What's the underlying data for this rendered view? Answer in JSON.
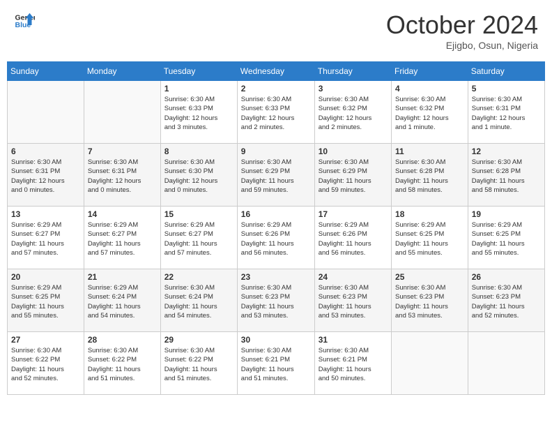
{
  "header": {
    "logo_line1": "General",
    "logo_line2": "Blue",
    "month": "October 2024",
    "location": "Ejigbo, Osun, Nigeria"
  },
  "days_of_week": [
    "Sunday",
    "Monday",
    "Tuesday",
    "Wednesday",
    "Thursday",
    "Friday",
    "Saturday"
  ],
  "weeks": [
    [
      {
        "num": "",
        "info": ""
      },
      {
        "num": "",
        "info": ""
      },
      {
        "num": "1",
        "info": "Sunrise: 6:30 AM\nSunset: 6:33 PM\nDaylight: 12 hours\nand 3 minutes."
      },
      {
        "num": "2",
        "info": "Sunrise: 6:30 AM\nSunset: 6:33 PM\nDaylight: 12 hours\nand 2 minutes."
      },
      {
        "num": "3",
        "info": "Sunrise: 6:30 AM\nSunset: 6:32 PM\nDaylight: 12 hours\nand 2 minutes."
      },
      {
        "num": "4",
        "info": "Sunrise: 6:30 AM\nSunset: 6:32 PM\nDaylight: 12 hours\nand 1 minute."
      },
      {
        "num": "5",
        "info": "Sunrise: 6:30 AM\nSunset: 6:31 PM\nDaylight: 12 hours\nand 1 minute."
      }
    ],
    [
      {
        "num": "6",
        "info": "Sunrise: 6:30 AM\nSunset: 6:31 PM\nDaylight: 12 hours\nand 0 minutes."
      },
      {
        "num": "7",
        "info": "Sunrise: 6:30 AM\nSunset: 6:31 PM\nDaylight: 12 hours\nand 0 minutes."
      },
      {
        "num": "8",
        "info": "Sunrise: 6:30 AM\nSunset: 6:30 PM\nDaylight: 12 hours\nand 0 minutes."
      },
      {
        "num": "9",
        "info": "Sunrise: 6:30 AM\nSunset: 6:29 PM\nDaylight: 11 hours\nand 59 minutes."
      },
      {
        "num": "10",
        "info": "Sunrise: 6:30 AM\nSunset: 6:29 PM\nDaylight: 11 hours\nand 59 minutes."
      },
      {
        "num": "11",
        "info": "Sunrise: 6:30 AM\nSunset: 6:28 PM\nDaylight: 11 hours\nand 58 minutes."
      },
      {
        "num": "12",
        "info": "Sunrise: 6:30 AM\nSunset: 6:28 PM\nDaylight: 11 hours\nand 58 minutes."
      }
    ],
    [
      {
        "num": "13",
        "info": "Sunrise: 6:29 AM\nSunset: 6:27 PM\nDaylight: 11 hours\nand 57 minutes."
      },
      {
        "num": "14",
        "info": "Sunrise: 6:29 AM\nSunset: 6:27 PM\nDaylight: 11 hours\nand 57 minutes."
      },
      {
        "num": "15",
        "info": "Sunrise: 6:29 AM\nSunset: 6:27 PM\nDaylight: 11 hours\nand 57 minutes."
      },
      {
        "num": "16",
        "info": "Sunrise: 6:29 AM\nSunset: 6:26 PM\nDaylight: 11 hours\nand 56 minutes."
      },
      {
        "num": "17",
        "info": "Sunrise: 6:29 AM\nSunset: 6:26 PM\nDaylight: 11 hours\nand 56 minutes."
      },
      {
        "num": "18",
        "info": "Sunrise: 6:29 AM\nSunset: 6:25 PM\nDaylight: 11 hours\nand 55 minutes."
      },
      {
        "num": "19",
        "info": "Sunrise: 6:29 AM\nSunset: 6:25 PM\nDaylight: 11 hours\nand 55 minutes."
      }
    ],
    [
      {
        "num": "20",
        "info": "Sunrise: 6:29 AM\nSunset: 6:25 PM\nDaylight: 11 hours\nand 55 minutes."
      },
      {
        "num": "21",
        "info": "Sunrise: 6:29 AM\nSunset: 6:24 PM\nDaylight: 11 hours\nand 54 minutes."
      },
      {
        "num": "22",
        "info": "Sunrise: 6:30 AM\nSunset: 6:24 PM\nDaylight: 11 hours\nand 54 minutes."
      },
      {
        "num": "23",
        "info": "Sunrise: 6:30 AM\nSunset: 6:23 PM\nDaylight: 11 hours\nand 53 minutes."
      },
      {
        "num": "24",
        "info": "Sunrise: 6:30 AM\nSunset: 6:23 PM\nDaylight: 11 hours\nand 53 minutes."
      },
      {
        "num": "25",
        "info": "Sunrise: 6:30 AM\nSunset: 6:23 PM\nDaylight: 11 hours\nand 53 minutes."
      },
      {
        "num": "26",
        "info": "Sunrise: 6:30 AM\nSunset: 6:23 PM\nDaylight: 11 hours\nand 52 minutes."
      }
    ],
    [
      {
        "num": "27",
        "info": "Sunrise: 6:30 AM\nSunset: 6:22 PM\nDaylight: 11 hours\nand 52 minutes."
      },
      {
        "num": "28",
        "info": "Sunrise: 6:30 AM\nSunset: 6:22 PM\nDaylight: 11 hours\nand 51 minutes."
      },
      {
        "num": "29",
        "info": "Sunrise: 6:30 AM\nSunset: 6:22 PM\nDaylight: 11 hours\nand 51 minutes."
      },
      {
        "num": "30",
        "info": "Sunrise: 6:30 AM\nSunset: 6:21 PM\nDaylight: 11 hours\nand 51 minutes."
      },
      {
        "num": "31",
        "info": "Sunrise: 6:30 AM\nSunset: 6:21 PM\nDaylight: 11 hours\nand 50 minutes."
      },
      {
        "num": "",
        "info": ""
      },
      {
        "num": "",
        "info": ""
      }
    ]
  ]
}
